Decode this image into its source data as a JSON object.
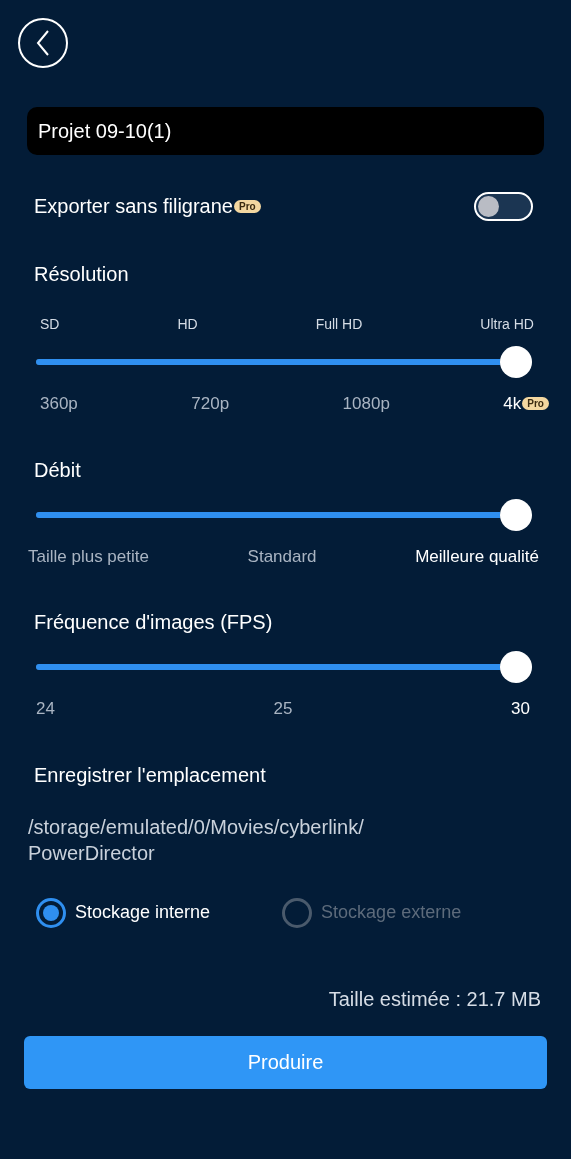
{
  "project_name": {
    "value": "Projet 09-10(1)"
  },
  "watermark": {
    "label": "Exporter sans filigrane",
    "badge": "Pro",
    "on": false
  },
  "sliders": [
    {
      "title": "Résolution",
      "level": 1,
      "top_labels": [
        "SD",
        "HD",
        "Full HD",
        "Ultra HD"
      ],
      "labels": [
        {
          "text": "360p",
          "selected": false
        },
        {
          "text": "720p",
          "selected": false
        },
        {
          "text": "1080p",
          "selected": false
        },
        {
          "text": "4k",
          "badge": "Pro",
          "selected": true
        }
      ]
    },
    {
      "title": "Débit",
      "level": 1,
      "labels": [
        {
          "text": "Taille plus petite",
          "selected": false
        },
        {
          "text": "Standard",
          "selected": false
        },
        {
          "text": "Meilleure qualité",
          "selected": true
        }
      ]
    },
    {
      "title": "Fréquence d'images (FPS)",
      "level": 1,
      "labels": [
        {
          "text": "24",
          "selected": false
        },
        {
          "text": "25",
          "selected": false
        },
        {
          "text": "30",
          "selected": true
        }
      ]
    }
  ],
  "location": {
    "title": "Enregistrer l'emplacement",
    "path_lines": [
      "/storage/emulated/0/Movies/cyberlink/",
      "PowerDirector"
    ]
  },
  "storage": [
    {
      "label": "Stockage interne",
      "selected": true
    },
    {
      "label": "Stockage externe",
      "selected": false
    }
  ],
  "estimate": "Taille estimée : 21.7 MB",
  "produce_button": "Produire"
}
